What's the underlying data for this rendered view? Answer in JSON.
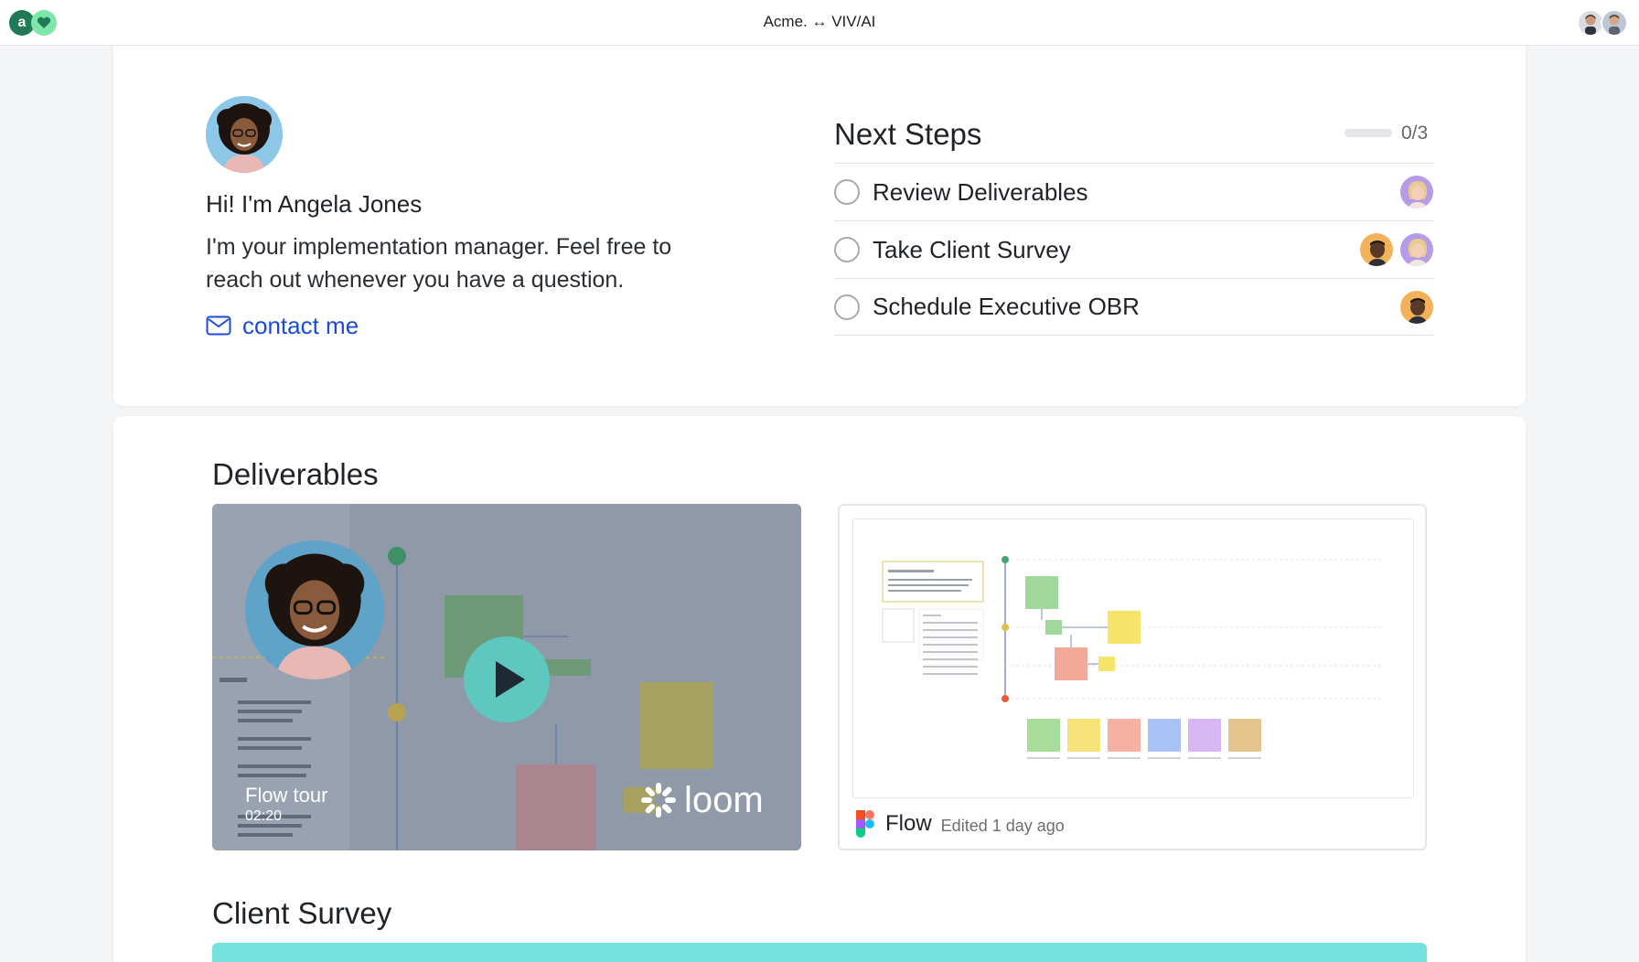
{
  "topbar": {
    "title": "Acme. ↔ VIV/AI",
    "logo_letter": "a"
  },
  "intro": {
    "greeting": "Hi! I'm Angela Jones",
    "message": "I'm your implementation manager. Feel free to reach out whenever you have a question.",
    "contact_label": "contact me"
  },
  "next_steps": {
    "title": "Next Steps",
    "progress_count": "0/3",
    "progress_fraction": 0,
    "items": [
      {
        "label": "Review Deliverables"
      },
      {
        "label": "Take Client Survey"
      },
      {
        "label": "Schedule Executive OBR"
      }
    ]
  },
  "deliverables": {
    "title": "Deliverables",
    "video": {
      "name": "Flow tour",
      "duration": "02:20",
      "brand": "loom"
    },
    "figma": {
      "name": "Flow",
      "edited": "Edited 1 day ago"
    }
  },
  "survey": {
    "title": "Client Survey"
  },
  "colors": {
    "accent_link": "#1c4bd8",
    "logo_dark": "#1f7a57",
    "logo_light": "#7ee6a6",
    "play_button": "#5ec7bf",
    "survey_bar": "#74e2dd"
  }
}
